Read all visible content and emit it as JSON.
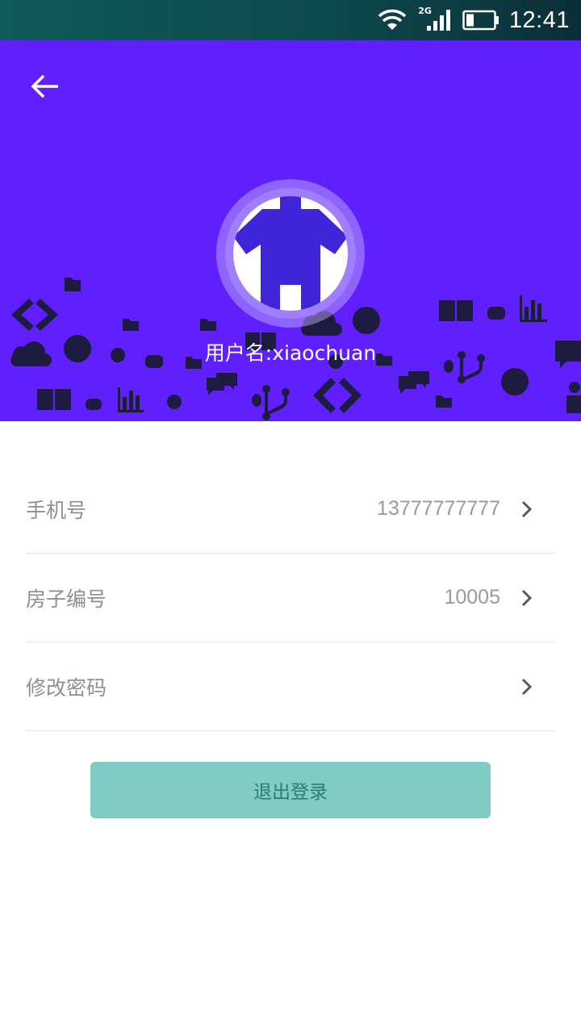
{
  "status_bar": {
    "network_type": "2G",
    "time": "12:41",
    "icons": [
      "wifi-icon",
      "signal-icon",
      "battery-icon"
    ]
  },
  "header": {
    "background_color": "#601ffd",
    "back_icon": "arrow-left-icon",
    "username_label": "用户名:xiaochuan"
  },
  "list": {
    "items": [
      {
        "label": "手机号",
        "value": "13777777777"
      },
      {
        "label": "房子编号",
        "value": "10005"
      },
      {
        "label": "修改密码",
        "value": ""
      }
    ]
  },
  "logout": {
    "label": "退出登录",
    "color": "#80cbc4"
  }
}
